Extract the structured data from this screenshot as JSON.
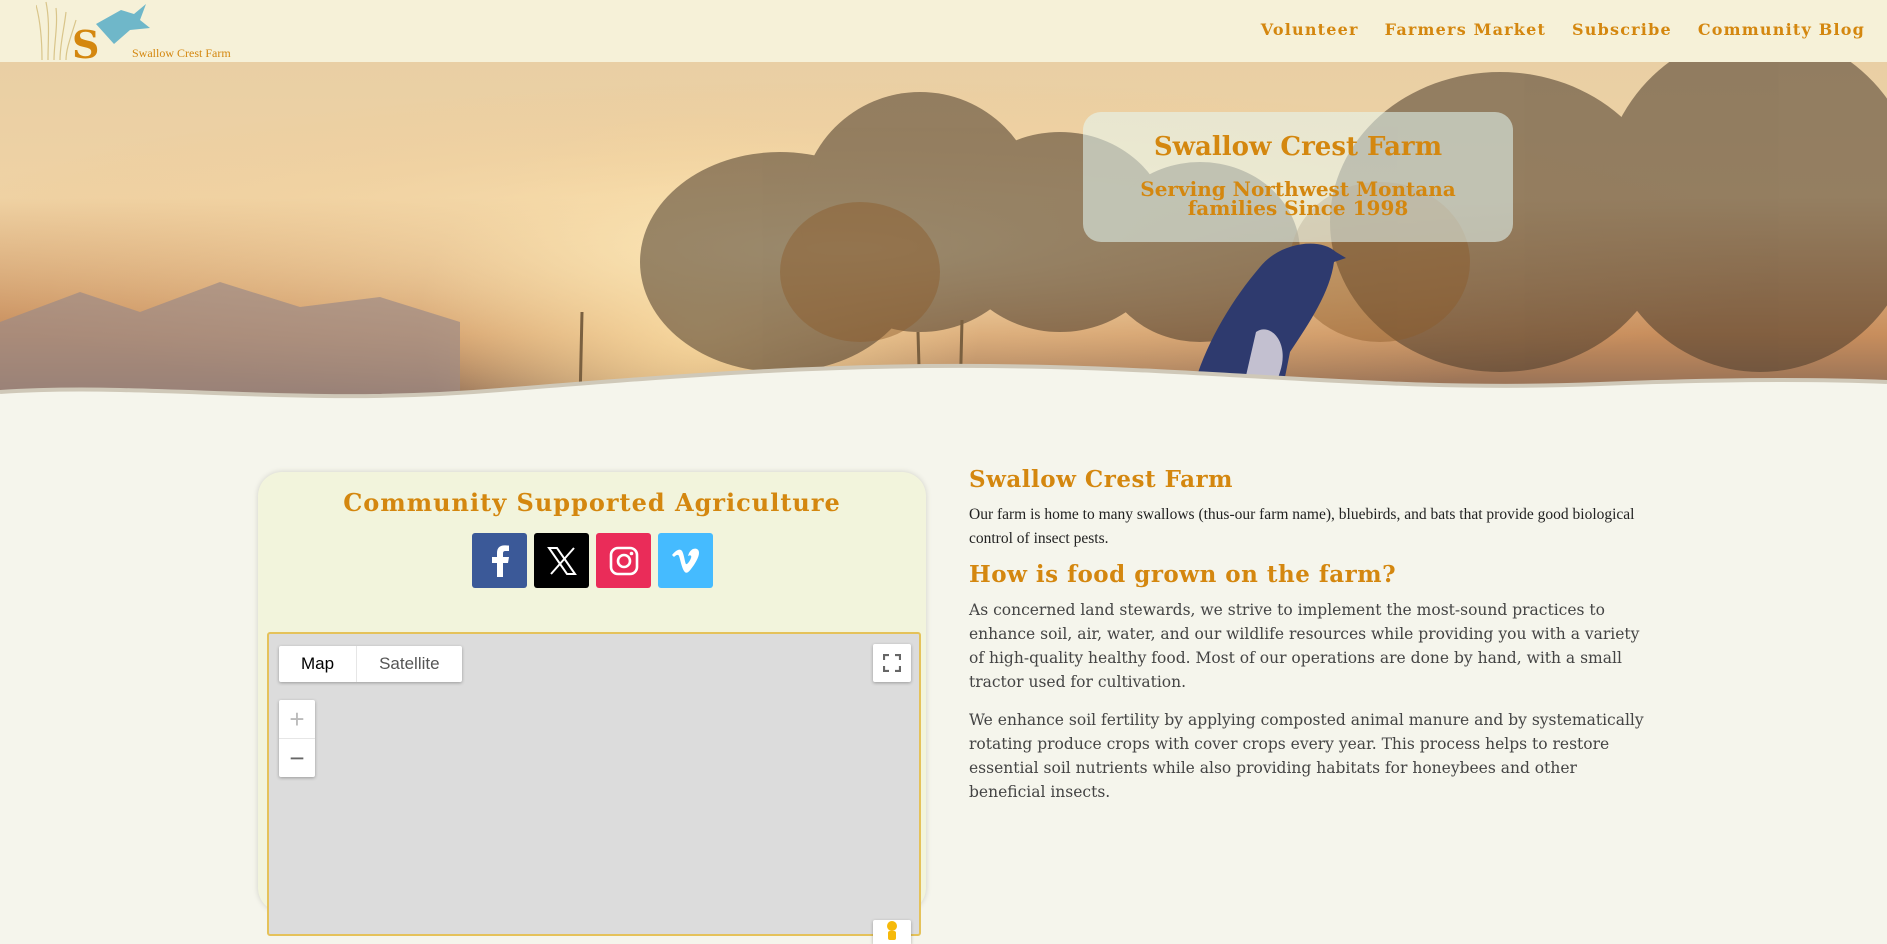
{
  "header": {
    "logo_text": "Swallow Crest Farm",
    "nav": [
      "Volunteer",
      "Farmers Market",
      "Subscribe",
      "Community Blog"
    ]
  },
  "hero": {
    "title": "Swallow Crest Farm",
    "subtitle_line1": "Serving Northwest Montana",
    "subtitle_line2": "families Since 1998"
  },
  "csa": {
    "title": "Community Supported Agriculture",
    "socials": [
      "facebook-icon",
      "x-icon",
      "instagram-icon",
      "vimeo-icon"
    ]
  },
  "map": {
    "type_map": "Map",
    "type_satellite": "Satellite",
    "zoom_in": "+",
    "zoom_out": "−"
  },
  "content": {
    "heading1": "Swallow Crest Farm",
    "intro": "Our farm is home to many swallows (thus-our farm name), bluebirds, and bats that provide good biological control of insect pests.",
    "heading2": "How is food grown on the farm?",
    "para1": "As concerned land stewards, we strive to implement the most-sound practices to enhance soil, air, water, and our wildlife resources while providing you with a variety of high-quality healthy food. Most of our operations are done by hand, with a small tractor used for cultivation.",
    "para2": "We enhance soil fertility by applying composted animal manure and by systematically rotating produce crops with cover crops every year. This process helps to restore essential soil nutrients while also providing habitats for honeybees and other beneficial insects."
  },
  "colors": {
    "accent": "#d4870f",
    "header_bg": "#f6f1d8",
    "page_bg": "#f5f5ec",
    "card_bg": "#f2f4dc"
  }
}
